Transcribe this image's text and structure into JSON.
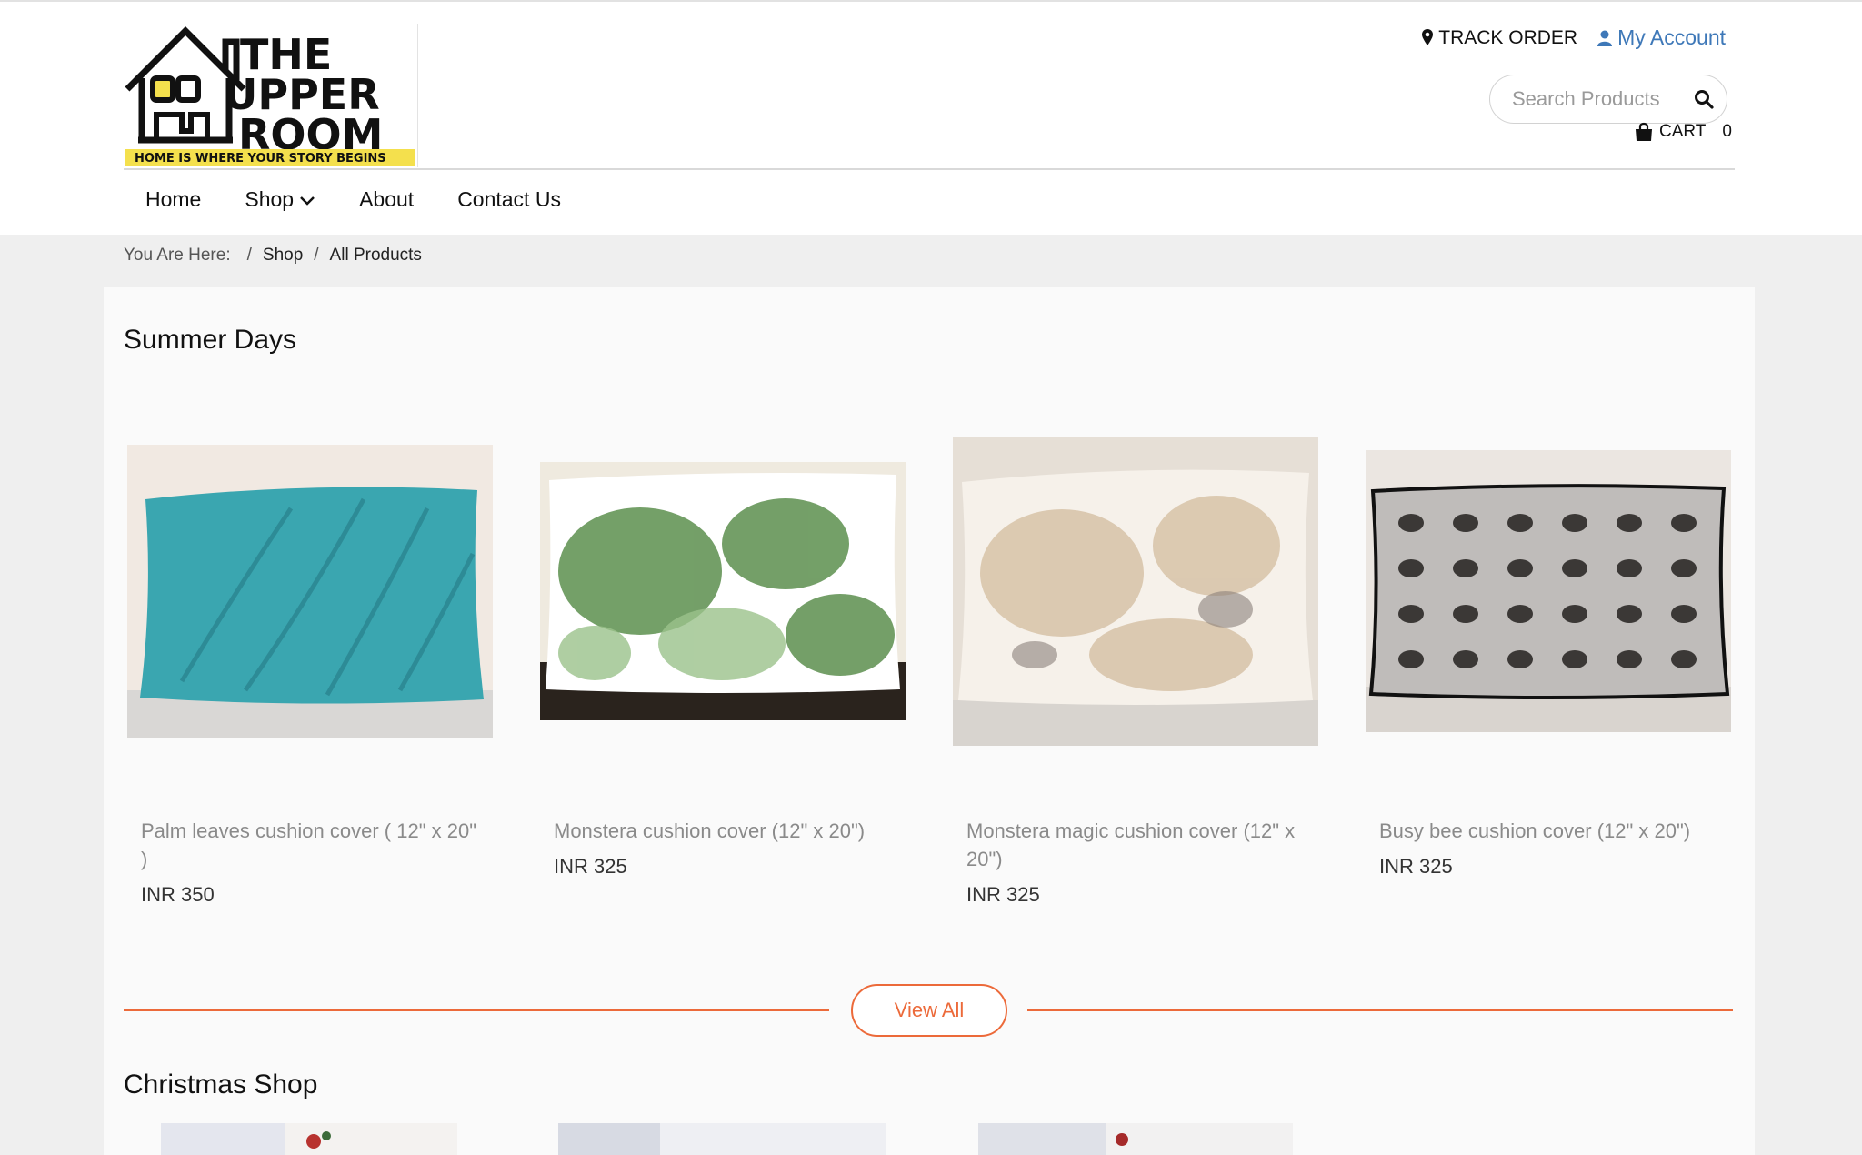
{
  "header": {
    "logo": {
      "line1": "THE",
      "line2": "UPPER",
      "line3": "ROOM",
      "tagline": "HOME IS WHERE YOUR STORY BEGINS"
    },
    "track_order": "TRACK ORDER",
    "my_account": "My Account",
    "search_placeholder": "Search Products",
    "cart_label": "CART",
    "cart_count": "0"
  },
  "nav": {
    "home": "Home",
    "shop": "Shop",
    "about": "About",
    "contact": "Contact Us"
  },
  "breadcrumb": {
    "prefix": "You Are Here:",
    "sep": "/",
    "shop": "Shop",
    "current": "All Products"
  },
  "sections": {
    "summer_title": "Summer Days",
    "christmas_title": "Christmas Shop",
    "view_all": "View All"
  },
  "products": [
    {
      "name": "Palm leaves cushion cover ( 12\" x 20\" )",
      "price": "INR 350"
    },
    {
      "name": "Monstera cushion cover (12\" x 20\")",
      "price": "INR 325"
    },
    {
      "name": "Monstera magic cushion cover (12\" x 20\")",
      "price": "INR 325"
    },
    {
      "name": "Busy bee cushion cover (12\" x 20\")",
      "price": "INR 325"
    }
  ],
  "colors": {
    "accent": "#ec6a3a",
    "account_link": "#3e78b8",
    "logo_yellow": "#f4e04d"
  }
}
